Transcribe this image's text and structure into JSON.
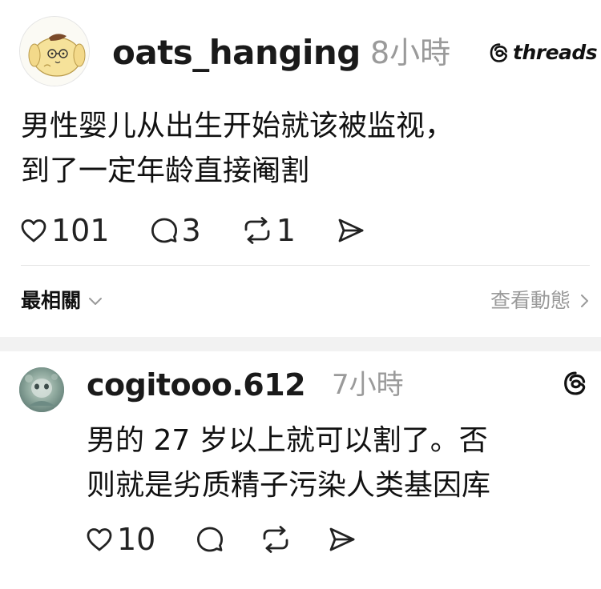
{
  "post": {
    "username": "oats_hanging",
    "time": "8小時",
    "brand": "threads",
    "text_lines": [
      "男性婴儿从出生开始就该被监视，",
      "到了一定年龄直接阉割"
    ],
    "likes": "101",
    "comments": "3",
    "reposts": "1"
  },
  "sortbar": {
    "label": "最相關",
    "view_activity": "查看動態"
  },
  "reply": {
    "username": "cogitooo.612",
    "time": "7小時",
    "text_lines": [
      "男的 27 岁以上就可以割了。否",
      "则就是劣质精子污染人类基因库"
    ],
    "likes": "10"
  },
  "icons": {
    "like": "heart-icon",
    "comment": "comment-bubble-icon",
    "repost": "repost-icon",
    "share": "send-icon",
    "brand": "threads-logo-icon",
    "sort": "chevron-down-icon",
    "view": "chevron-right-icon"
  },
  "colors": {
    "text": "#111111",
    "muted": "#9a9a9a",
    "divider": "#e3e3e3",
    "band": "#f2f2f2"
  }
}
